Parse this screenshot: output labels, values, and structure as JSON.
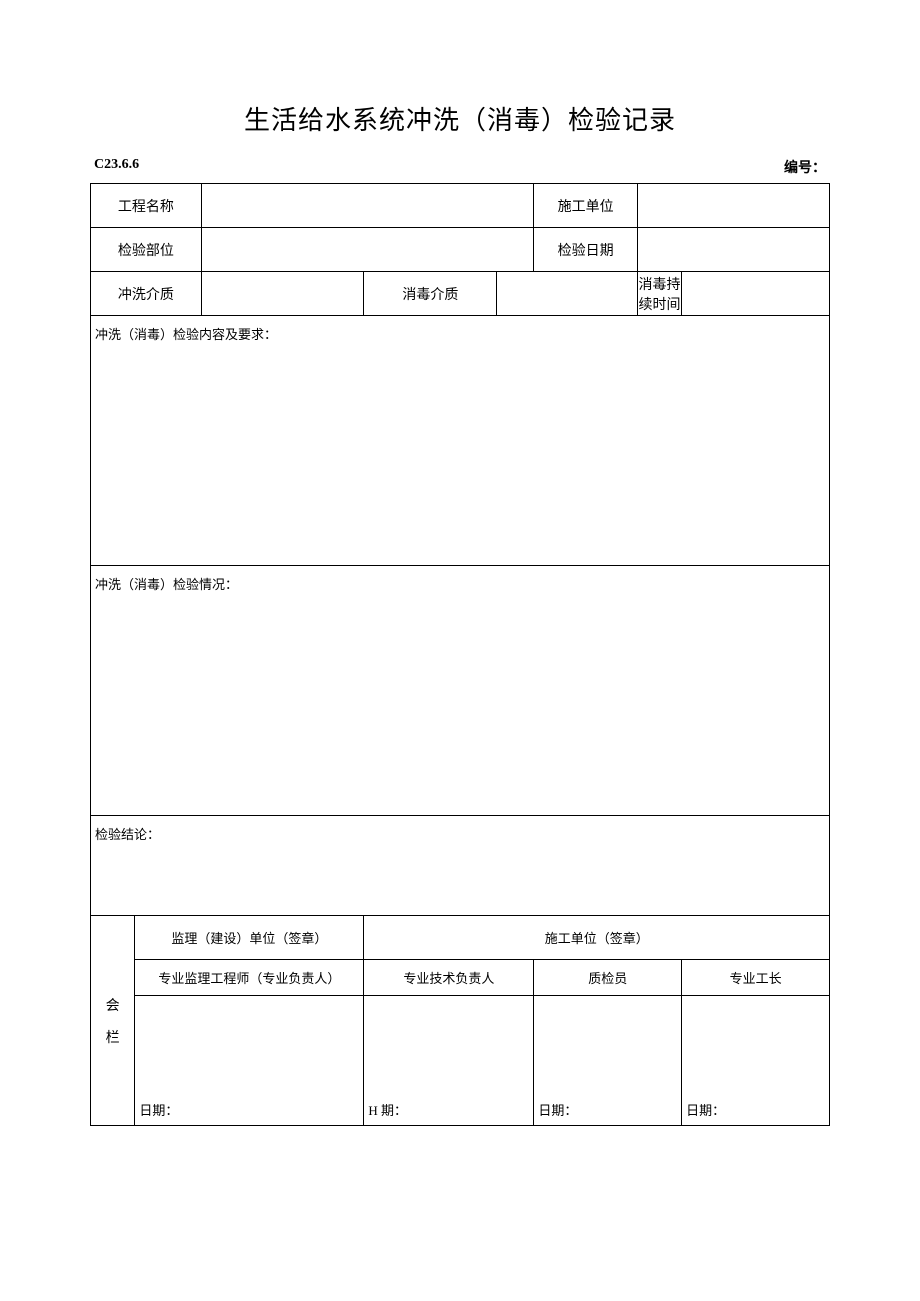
{
  "title": "生活给水系统冲洗（消毒）检验记录",
  "header": {
    "code": "C23.6.6",
    "number_label": "编号：",
    "number_value": ""
  },
  "rows": {
    "r1": {
      "project_name_label": "工程名称",
      "project_name_value": "",
      "contractor_label": "施工单位",
      "contractor_value": ""
    },
    "r2": {
      "part_label": "检验部位",
      "part_value": "",
      "date_label": "检验日期",
      "date_value": ""
    },
    "r3": {
      "flush_medium_label": "冲洗介质",
      "flush_medium_value": "",
      "disinfect_medium_label": "消毒介质",
      "disinfect_medium_value": "",
      "duration_label": "消毒持续时间",
      "duration_value": ""
    }
  },
  "sections": {
    "content_req": "冲洗（消毒）检验内容及要求：",
    "situation": "冲洗（消毒）检验情况：",
    "conclusion": "检验结论："
  },
  "signoff": {
    "side_label_chars": [
      "会",
      "栏"
    ],
    "supervision_header": "监理（建设）单位（签章）",
    "contractor_header": "施工单位（签章）",
    "roles": {
      "supervisor": "专业监理工程师（专业负责人）",
      "tech_lead": "专业技术负责人",
      "qc": "质检员",
      "foreman": "专业工长"
    },
    "date_labels": {
      "d1": "日期：",
      "d2": "H 期：",
      "d3": "日期：",
      "d4": "日期："
    }
  }
}
